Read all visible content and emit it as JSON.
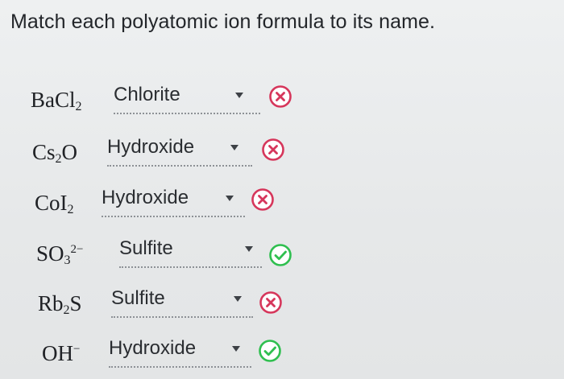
{
  "question": {
    "prompt": "Match each polyatomic ion formula to its name."
  },
  "rows": [
    {
      "formula": {
        "base1": "BaCl",
        "sub1": "2",
        "base2": "",
        "sub2": "",
        "charge": ""
      },
      "selected": "Chlorite",
      "result": "incorrect",
      "result_icon": "x-circle-icon"
    },
    {
      "formula": {
        "base1": "Cs",
        "sub1": "2",
        "base2": "O",
        "sub2": "",
        "charge": ""
      },
      "selected": "Hydroxide",
      "result": "incorrect",
      "result_icon": "x-circle-icon"
    },
    {
      "formula": {
        "base1": "CoI",
        "sub1": "2",
        "base2": "",
        "sub2": "",
        "charge": ""
      },
      "selected": "Hydroxide",
      "result": "incorrect",
      "result_icon": "x-circle-icon"
    },
    {
      "formula": {
        "base1": "SO",
        "sub1": "3",
        "base2": "",
        "sub2": "",
        "charge": "2−"
      },
      "selected": "Sulfite",
      "result": "correct",
      "result_icon": "check-circle-icon"
    },
    {
      "formula": {
        "base1": "Rb",
        "sub1": "2",
        "base2": "S",
        "sub2": "",
        "charge": ""
      },
      "selected": "Sulfite",
      "result": "incorrect",
      "result_icon": "x-circle-icon"
    },
    {
      "formula": {
        "base1": "OH",
        "sub1": "",
        "base2": "",
        "sub2": "",
        "charge": "−"
      },
      "selected": "Hydroxide",
      "result": "correct",
      "result_icon": "check-circle-icon"
    }
  ],
  "colors": {
    "incorrect": "#d6365b",
    "correct": "#2fbf4f",
    "background": "#e9ebec",
    "dotted_underline": "#8d9196"
  }
}
